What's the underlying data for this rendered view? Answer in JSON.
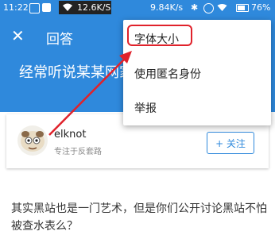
{
  "status_bar": {
    "time": "11:22",
    "speed": "12.6K/S",
    "net_speed": "9.84K/s",
    "battery": "76%"
  },
  "app_bar": {
    "close_icon": "✕",
    "title": "回答"
  },
  "question": {
    "title": "经常听说某某网家网站的基本原"
  },
  "author": {
    "name": "elknot",
    "description": "专注于反套路",
    "follow_label": "+ 关注"
  },
  "menu": {
    "items": [
      {
        "label": "字体大小"
      },
      {
        "label": "使用匿名身份"
      },
      {
        "label": "举报"
      }
    ]
  },
  "answer": {
    "text": "其实黑站也是一门艺术，但是你们公开讨论黑站不怕被查水表么？"
  },
  "colors": {
    "brand_blue": "#2f89dc",
    "annotation_red": "#e0222b"
  },
  "icons": [
    "wifi-icon",
    "battery-icon",
    "close-icon",
    "avatar"
  ]
}
